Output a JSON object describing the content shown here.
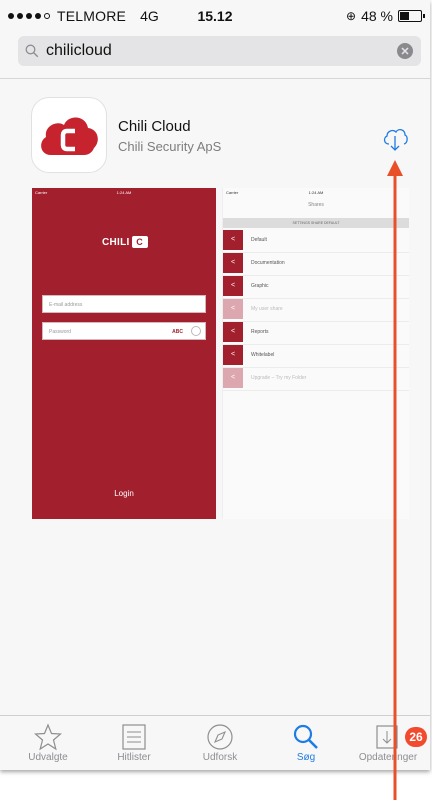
{
  "status_bar": {
    "carrier": "TELMORE",
    "network": "4G",
    "time": "15.12",
    "battery": "48 %",
    "battery_level": 0.48
  },
  "search": {
    "value": "chilicloud",
    "icon": "search-icon",
    "clear_icon": "clear-icon"
  },
  "app": {
    "name": "Chili Cloud",
    "developer": "Chili Security ApS",
    "icon": "chili-cloud-app-icon",
    "action_icon": "download-cloud-icon",
    "brand_color": "#a21f2e"
  },
  "screenshots": {
    "login": {
      "carrier": "Carrier",
      "time": "1:24 AM",
      "logo": "CHILI",
      "email_placeholder": "E-mail address",
      "password_placeholder": "Password",
      "password_hint": "ABC",
      "login_label": "Login"
    },
    "shares": {
      "carrier": "Carrier",
      "time": "1:24 AM",
      "title": "Shares",
      "header": "SETTINGS SHARE DEFAULT",
      "items": [
        {
          "label": "Default",
          "faded": false
        },
        {
          "label": "Documentation",
          "faded": false
        },
        {
          "label": "Graphic",
          "faded": false
        },
        {
          "label": "My user share",
          "faded": true
        },
        {
          "label": "Reports",
          "faded": false
        },
        {
          "label": "Whitelabel",
          "faded": false
        },
        {
          "label": "Upgrade – Try my Folder",
          "faded": true
        }
      ]
    }
  },
  "tab_bar": {
    "tabs": [
      {
        "label": "Udvalgte",
        "icon": "star-icon",
        "active": false
      },
      {
        "label": "Hitlister",
        "icon": "list-icon",
        "active": false
      },
      {
        "label": "Udforsk",
        "icon": "compass-icon",
        "active": false
      },
      {
        "label": "Søg",
        "icon": "search-icon",
        "active": true
      },
      {
        "label": "Opdateringer",
        "icon": "updates-icon",
        "active": false
      }
    ],
    "updates_badge": "26",
    "active_color": "#1f7ce3"
  },
  "annotation": {
    "arrow_color": "#e8502a",
    "target": "download-button"
  }
}
